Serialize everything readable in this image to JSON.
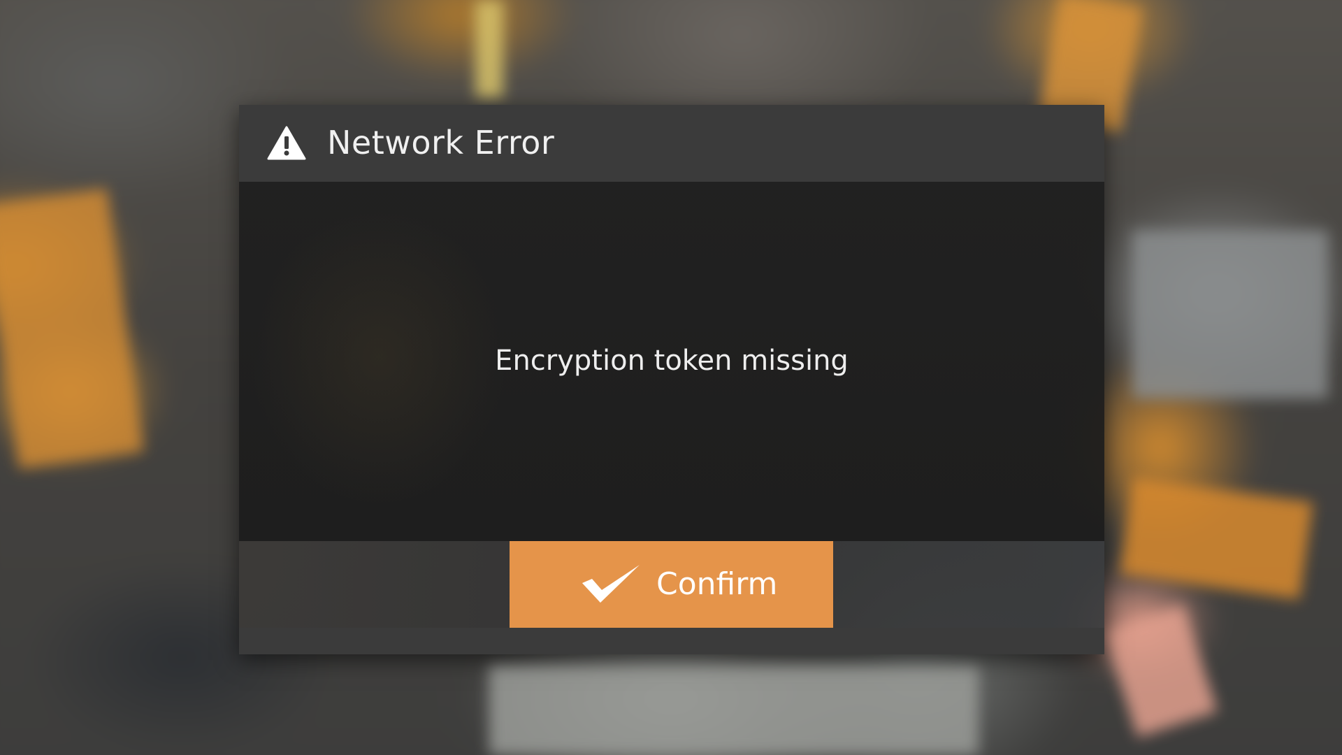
{
  "dialog": {
    "title": "Network Error",
    "message": "Encryption token missing",
    "icon": "warning-triangle-icon",
    "confirm_label": "Confirm",
    "confirm_icon": "checkmark-icon"
  },
  "colors": {
    "accent": "#e5944a",
    "header": "#3b3b3b",
    "body": "#1e1e1e",
    "text": "#f0f0f0"
  }
}
